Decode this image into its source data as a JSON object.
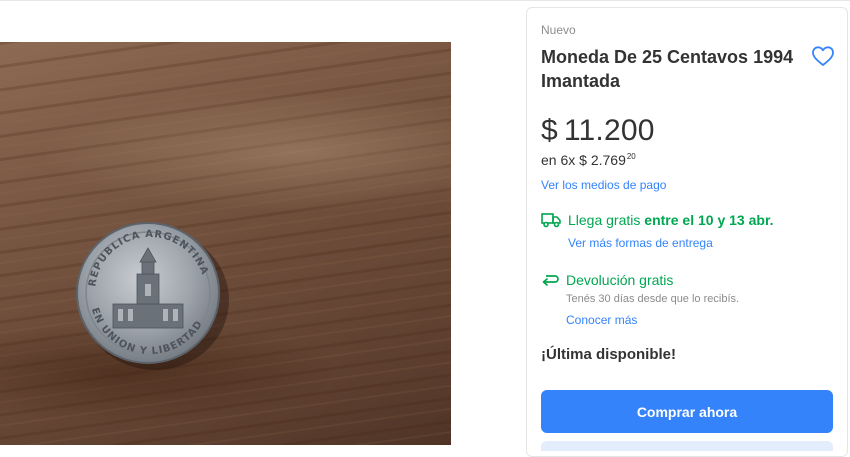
{
  "product": {
    "condition": "Nuevo",
    "title": "Moneda De 25 Centavos 1994 Imantada",
    "image_alt": "Moneda de 25 centavos República Argentina sobre mesa de madera",
    "coin_text_top": "REPUBLICA ARGENTINA",
    "coin_text_bottom": "EN UNION Y LIBERTAD"
  },
  "price": {
    "currency": "$",
    "amount": "11.200",
    "installments_prefix": "en 6x",
    "installment_amount": "$ 2.769",
    "installment_cents": "20",
    "payment_link": "Ver los medios de pago"
  },
  "shipping": {
    "icon": "truck-icon",
    "label_a": "Llega gratis",
    "label_b": "entre el",
    "date_1": "10",
    "label_c": "y",
    "date_2": "13 abr.",
    "link": "Ver más formas de entrega"
  },
  "returns": {
    "icon": "return-arrow-icon",
    "label": "Devolución gratis",
    "sub": "Tenés 30 días desde que lo recibís.",
    "link": "Conocer más"
  },
  "stock": {
    "label": "¡Última disponible!"
  },
  "actions": {
    "buy_label": "Comprar ahora"
  },
  "colors": {
    "accent": "#3483fa",
    "green": "#00a650",
    "muted": "#8c8c8c"
  }
}
